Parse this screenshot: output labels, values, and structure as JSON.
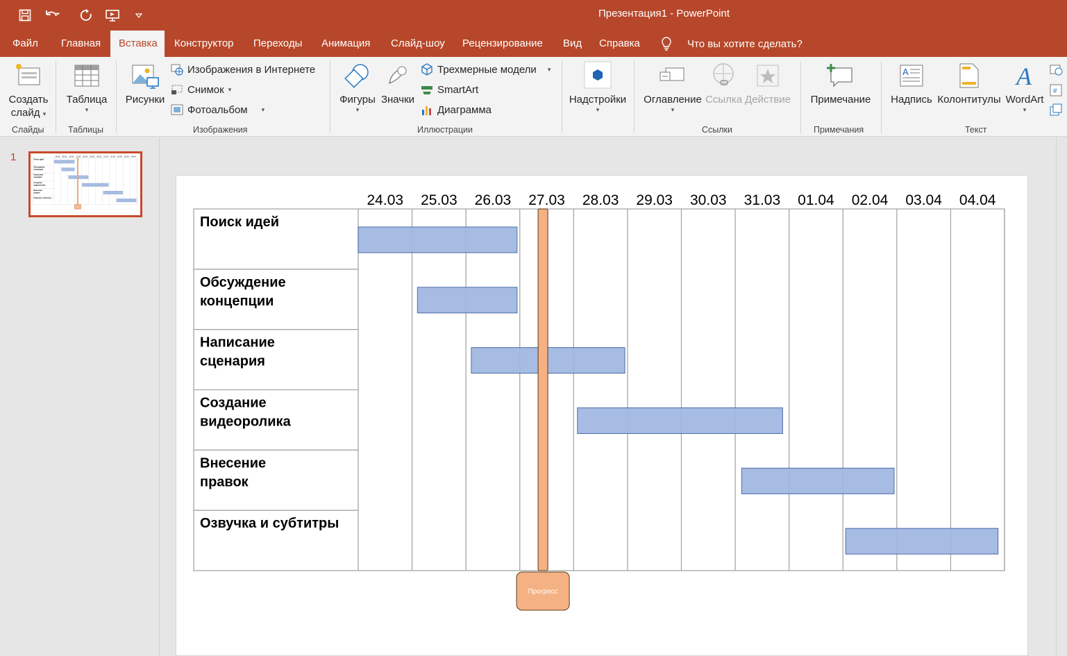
{
  "window": {
    "title": "Презентация1  -  PowerPoint"
  },
  "qat": {
    "icons": [
      "save-icon",
      "undo-icon",
      "redo-icon",
      "start-from-beginning-icon",
      "customize-qat-icon"
    ]
  },
  "tabs": [
    {
      "label": "Файл"
    },
    {
      "label": "Главная"
    },
    {
      "label": "Вставка"
    },
    {
      "label": "Конструктор"
    },
    {
      "label": "Переходы"
    },
    {
      "label": "Анимация"
    },
    {
      "label": "Слайд-шоу"
    },
    {
      "label": "Рецензирование"
    },
    {
      "label": "Вид"
    },
    {
      "label": "Справка"
    }
  ],
  "active_tab": "Вставка",
  "tell_me": {
    "placeholder": "Что вы хотите сделать?"
  },
  "ribbon": {
    "groups": {
      "slides": "Слайды",
      "tables": "Таблицы",
      "images": "Изображения",
      "illustrations": "Иллюстрации",
      "links": "Ссылки",
      "comments": "Примечания",
      "text": "Текст"
    },
    "new_slide": {
      "line1": "Создать",
      "line2": "слайд"
    },
    "table": "Таблица",
    "pictures": "Рисунки",
    "online_pictures": "Изображения в Интернете",
    "screenshot": "Снимок",
    "photo_album": "Фотоальбом",
    "shapes": "Фигуры",
    "icons": "Значки",
    "models_3d": "Трехмерные модели",
    "smartart": "SmartArt",
    "chart": "Диаграмма",
    "addins": "Надстройки",
    "toc": "Оглавление",
    "link": "Ссылка",
    "action": "Действие",
    "comment": "Примечание",
    "textbox": "Надпись",
    "header_footer": "Колонтитулы",
    "wordart": "WordArt"
  },
  "thumbnails": [
    {
      "number": "1"
    }
  ],
  "gantt": {
    "dates": [
      "24.03",
      "25.03",
      "26.03",
      "27.03",
      "28.03",
      "29.03",
      "30.03",
      "31.03",
      "01.04",
      "02.04",
      "03.04",
      "04.04"
    ],
    "tasks": [
      {
        "name": "Поиск идей",
        "start": 0.0,
        "end": 2.95
      },
      {
        "name": "Обсуждение концепции",
        "start": 1.1,
        "end": 2.95
      },
      {
        "name": "Написание сценария",
        "start": 2.1,
        "end": 4.95
      },
      {
        "name": "Создание видеоролика",
        "start": 4.07,
        "end": 7.88
      },
      {
        "name": "Внесение правок",
        "start": 7.12,
        "end": 9.95
      },
      {
        "name": "Озвучка и субтитры",
        "start": 9.05,
        "end": 11.88
      }
    ],
    "progress_label": "Прогресс",
    "progress_position": 3.43,
    "colors": {
      "bar": "#a0b6e0",
      "bar_border": "#4a6aa8",
      "progress": "#f4b183",
      "progress_border": "#5a3a1a",
      "grid": "#a6a6a6"
    }
  }
}
